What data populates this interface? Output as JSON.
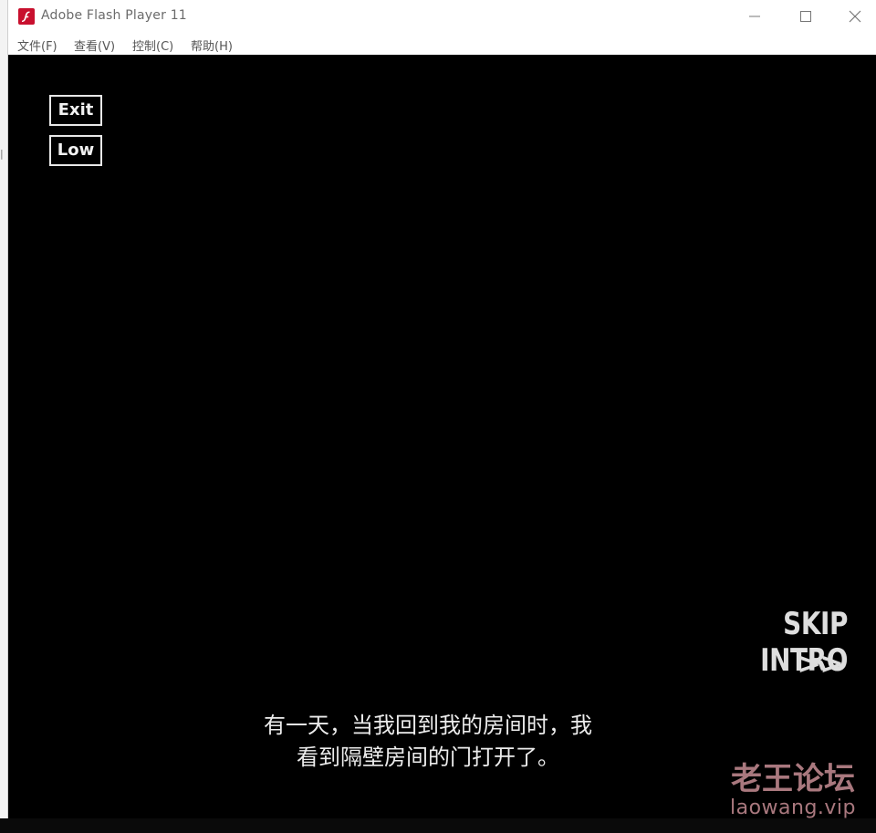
{
  "window": {
    "title": "Adobe Flash Player 11"
  },
  "menu": {
    "file": "文件(F)",
    "view": "查看(V)",
    "control": "控制(C)",
    "help": "帮助(H)"
  },
  "stage": {
    "exit_label": "Exit",
    "low_label": "Low",
    "skip_intro_label": "SKIP INTRO",
    "skip_arrows": ">>",
    "subtitle_line1": "有一天，当我回到我的房间时，我",
    "subtitle_line2": "看到隔壁房间的门打开了。"
  },
  "watermark": {
    "title": "老王论坛",
    "url": "laowang.vip"
  },
  "colors": {
    "stage_bg": "#000000",
    "flash_red": "#c8102e",
    "watermark": "#a9787e"
  },
  "icons": [
    "flash-app-icon",
    "minimize-icon",
    "maximize-icon",
    "close-icon"
  ]
}
